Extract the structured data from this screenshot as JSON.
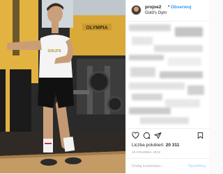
{
  "post": {
    "username": "projoe2",
    "separator": "•",
    "follow_label": "Obserwuj",
    "location": "Gold's Gym",
    "gym_sign": "OLYMPIA",
    "shirt_text": "GOLD'S",
    "likes_label": "Liczba polubień:",
    "likes_count": "20 311",
    "date": "19 GRUDNIA 2019",
    "comment_placeholder": "Dodaj komentarz...",
    "publish_label": "Opublikuj"
  },
  "icons": {
    "like": "heart-icon",
    "comment": "comment-icon",
    "share": "share-icon",
    "save": "bookmark-icon"
  },
  "colors": {
    "link": "#3897f0",
    "text": "#262626",
    "muted": "#999999",
    "gym_wall": "#e7b64a"
  }
}
